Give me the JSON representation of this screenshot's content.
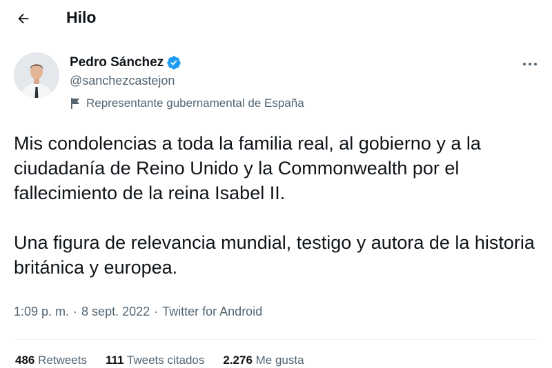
{
  "header": {
    "title": "Hilo",
    "back_icon": "arrow-left-icon"
  },
  "tweet": {
    "author": {
      "name": "Pedro Sánchez",
      "handle": "@sanchezcastejon",
      "verified": true,
      "label": "Representante gubernamental de España"
    },
    "paragraphs": [
      "Mis condolencias a toda la familia real, al gobierno y a la ciudadanía de Reino Unido y la Commonwealth por el fallecimiento de la reina Isabel II.",
      "Una figura de relevancia mundial, testigo y autora de la historia británica y europea."
    ],
    "time": "1:09 p. m.",
    "date": "8 sept. 2022",
    "source": "Twitter for Android",
    "separator": "·",
    "stats": [
      {
        "count": "486",
        "label": "Retweets"
      },
      {
        "count": "111",
        "label": "Tweets citados"
      },
      {
        "count": "2.276",
        "label": "Me gusta"
      }
    ]
  },
  "colors": {
    "text": "#0f1419",
    "secondary": "#536471",
    "verified": "#1d9bf0"
  }
}
